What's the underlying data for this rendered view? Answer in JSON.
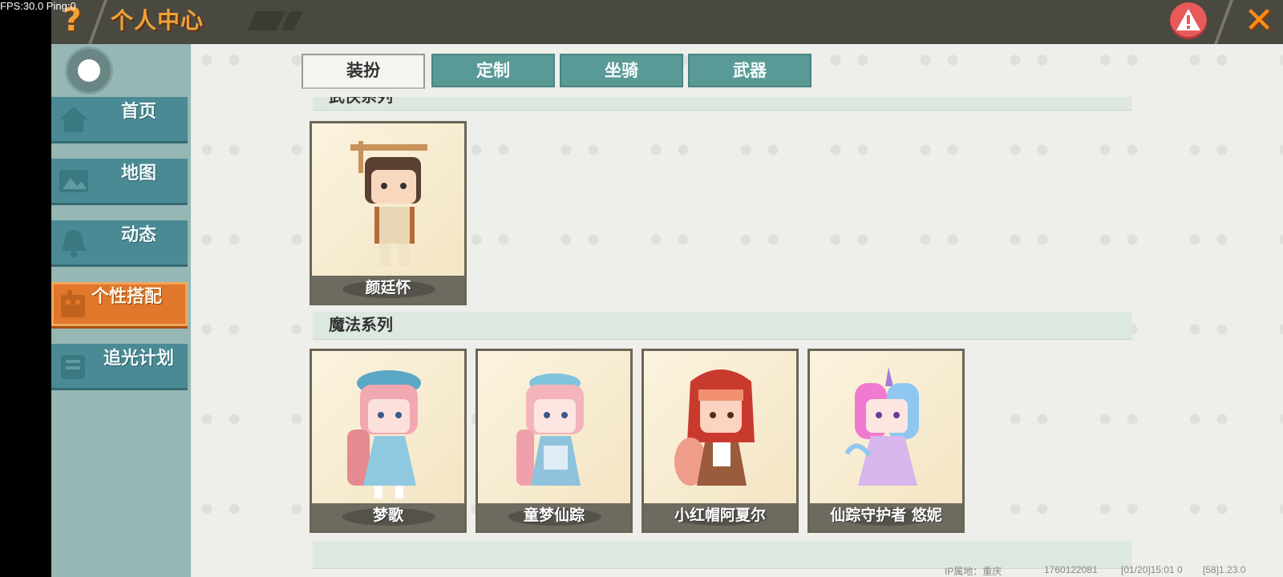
{
  "debug": {
    "fps_text": "FPS:30.0  Ping:0"
  },
  "header": {
    "title": "个人中心",
    "help_glyph": "?",
    "close_glyph": "✕"
  },
  "sidebar": {
    "items": [
      {
        "label": "首页",
        "icon": "home-icon"
      },
      {
        "label": "地图",
        "icon": "map-icon"
      },
      {
        "label": "动态",
        "icon": "bell-icon"
      },
      {
        "label": "个性搭配",
        "icon": "wardrobe-icon",
        "active": true
      },
      {
        "label": "追光计划",
        "icon": "plan-icon"
      }
    ]
  },
  "tabs": [
    {
      "label": "装扮",
      "active": true
    },
    {
      "label": "定制"
    },
    {
      "label": "坐骑"
    },
    {
      "label": "武器"
    }
  ],
  "sections": [
    {
      "title": "武侠系列",
      "cards": [
        {
          "name": "颜廷怀"
        }
      ]
    },
    {
      "title": "魔法系列",
      "cards": [
        {
          "name": "梦歌"
        },
        {
          "name": "童梦仙踪"
        },
        {
          "name": "小红帽阿夏尔"
        },
        {
          "name": "仙踪守护者 悠妮"
        }
      ]
    }
  ],
  "footer": {
    "ip": "IP属地：重庆",
    "uid": "1760122081",
    "time": "[01/20]15:01 0",
    "version": "[58]1.23.0"
  },
  "colors": {
    "accent": "#e0772a",
    "teal": "#5a9a96",
    "title": "#f0a13a"
  }
}
